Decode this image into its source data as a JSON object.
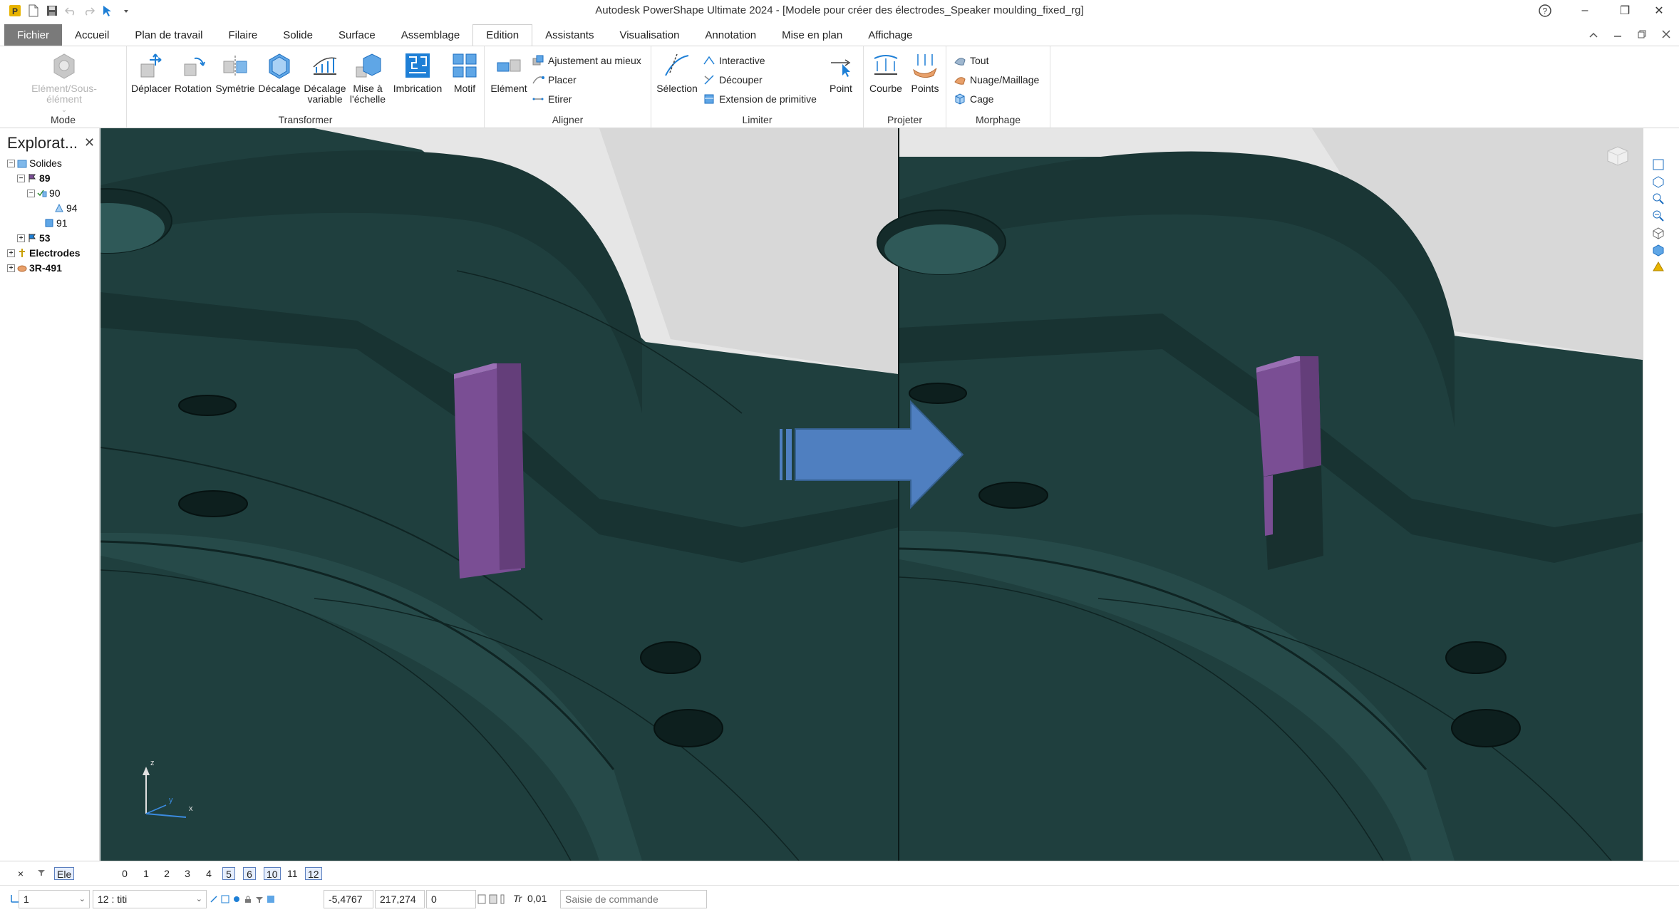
{
  "window": {
    "title": "Autodesk PowerShape Ultimate 2024 - [Modele pour créer des électrodes_Speaker moulding_fixed_rg]",
    "help": "?",
    "minimize": "–",
    "restore": "❐",
    "close": "✕"
  },
  "tabs": [
    "Fichier",
    "Accueil",
    "Plan de travail",
    "Filaire",
    "Solide",
    "Surface",
    "Assemblage",
    "Edition",
    "Assistants",
    "Visualisation",
    "Annotation",
    "Mise en plan",
    "Affichage"
  ],
  "active_tab": "Edition",
  "ribbon": {
    "mode": {
      "label": "Mode",
      "element_sous_element": "Elément/Sous-élément"
    },
    "transformer": {
      "label": "Transformer",
      "deplacer": "Déplacer",
      "rotation": "Rotation",
      "symetrie": "Symétrie",
      "decalage": "Décalage",
      "decalage_variable_1": "Décalage",
      "decalage_variable_2": "variable",
      "mise_echelle_1": "Mise à",
      "mise_echelle_2": "l'échelle",
      "imbrication": "Imbrication",
      "motif": "Motif"
    },
    "aligner": {
      "label": "Aligner",
      "element": "Elément",
      "ajustement": "Ajustement au mieux",
      "placer": "Placer",
      "etirer": "Etirer"
    },
    "limiter": {
      "label": "Limiter",
      "selection": "Sélection",
      "interactive": "Interactive",
      "decouper": "Découper",
      "extension": "Extension de primitive",
      "point": "Point"
    },
    "projeter": {
      "label": "Projeter",
      "courbe": "Courbe",
      "points": "Points"
    },
    "morphage": {
      "label": "Morphage",
      "tout": "Tout",
      "nuage": "Nuage/Maillage",
      "cage": "Cage"
    }
  },
  "explorer": {
    "title": "Explorat...",
    "close": "✕",
    "tree": [
      {
        "label": "Solides",
        "bold": false
      },
      {
        "label": "89",
        "bold": true
      },
      {
        "label": "90",
        "bold": false
      },
      {
        "label": "94",
        "bold": false
      },
      {
        "label": "91",
        "bold": false
      },
      {
        "label": "53",
        "bold": true
      },
      {
        "label": "Electrodes",
        "bold": true
      },
      {
        "label": "3R-491",
        "bold": true
      }
    ]
  },
  "axes": {
    "z": "z",
    "x": "x",
    "y": "y"
  },
  "levels": {
    "close": "×",
    "ele": "Ele",
    "items": [
      {
        "label": "0",
        "on": false
      },
      {
        "label": "1",
        "on": false
      },
      {
        "label": "2",
        "on": false
      },
      {
        "label": "3",
        "on": false
      },
      {
        "label": "4",
        "on": false
      },
      {
        "label": "5",
        "on": true
      },
      {
        "label": "6",
        "on": true
      },
      {
        "label": "10",
        "on": true
      },
      {
        "label": "11",
        "on": false
      },
      {
        "label": "12",
        "on": true
      }
    ]
  },
  "commandbar": {
    "workplane": "1",
    "level": "12 : titi",
    "coord_x": "-5,4767",
    "coord_y": "217,274",
    "coord_z": "0",
    "tolerance_label": "Tr",
    "tolerance": "0,01",
    "command_placeholder": "Saisie de commande"
  },
  "colors": {
    "mold": "#1f3f3e",
    "mold_light": "#2b5251",
    "electrode": "#7a4e94",
    "arrow": "#4f7fc0",
    "accent": "#1e7fd6"
  }
}
